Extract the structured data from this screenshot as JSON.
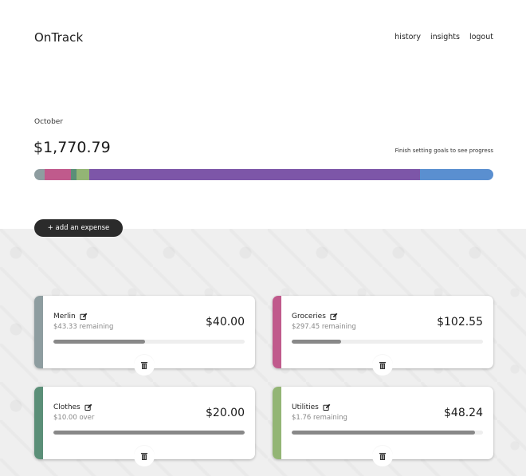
{
  "header": {
    "brand": "OnTrack",
    "nav": [
      {
        "label": "history"
      },
      {
        "label": "insights"
      },
      {
        "label": "logout"
      }
    ]
  },
  "summary": {
    "month": "October",
    "total": "$1,770.79",
    "goal_hint": "Finish setting goals to see progress",
    "segments": [
      {
        "color": "#8e9da0",
        "share": 0.0226
      },
      {
        "color": "#c05a8c",
        "share": 0.058
      },
      {
        "color": "#5b8f78",
        "share": 0.0113
      },
      {
        "color": "#93b575",
        "share": 0.0272
      },
      {
        "color": "#7d56a8",
        "share": 0.7213
      },
      {
        "color": "#5a8fd0",
        "share": 0.1596
      }
    ]
  },
  "actions": {
    "add_expense": "+ add an expense"
  },
  "categories": [
    {
      "name": "Merlin",
      "status": "$43.33 remaining",
      "amount": "$40.00",
      "progress": 0.48,
      "color": "#8e9da0"
    },
    {
      "name": "Groceries",
      "status": "$297.45 remaining",
      "amount": "$102.55",
      "progress": 0.26,
      "color": "#c05a8c"
    },
    {
      "name": "Clothes",
      "status": "$10.00 over",
      "amount": "$20.00",
      "progress": 1.0,
      "color": "#5b8f78"
    },
    {
      "name": "Utilities",
      "status": "$1.76 remaining",
      "amount": "$48.24",
      "progress": 0.96,
      "color": "#93b575"
    }
  ],
  "icons": {
    "edit": "edit-icon",
    "delete": "trash-icon"
  }
}
